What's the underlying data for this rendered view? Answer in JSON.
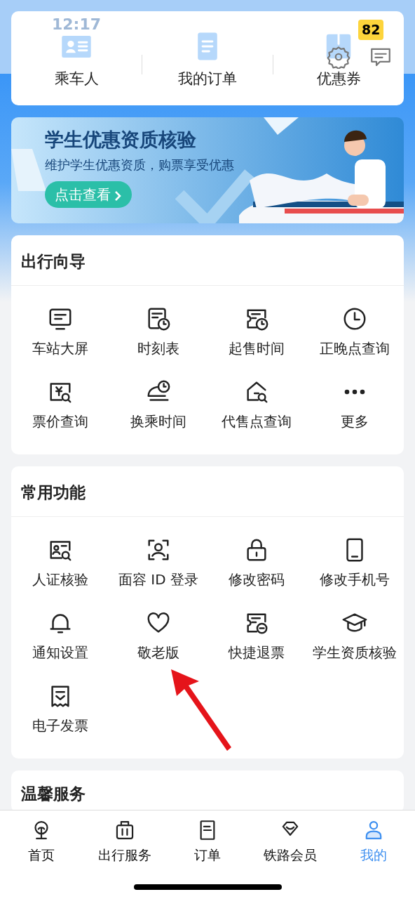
{
  "status_bar": {
    "time": "12:17",
    "badge": "82"
  },
  "shortcuts": [
    {
      "label": "乘车人"
    },
    {
      "label": "我的订单"
    },
    {
      "label": "优惠券"
    }
  ],
  "banner": {
    "title": "学生优惠资质核验",
    "subtitle": "维护学生优惠资质，购票享受优惠",
    "button": "点击查看"
  },
  "sections": [
    {
      "title": "出行向导",
      "items": [
        {
          "label": "车站大屏"
        },
        {
          "label": "时刻表"
        },
        {
          "label": "起售时间"
        },
        {
          "label": "正晚点查询"
        },
        {
          "label": "票价查询"
        },
        {
          "label": "换乘时间"
        },
        {
          "label": "代售点查询"
        },
        {
          "label": "更多"
        }
      ]
    },
    {
      "title": "常用功能",
      "items": [
        {
          "label": "人证核验"
        },
        {
          "label": "面容 ID 登录"
        },
        {
          "label": "修改密码"
        },
        {
          "label": "修改手机号"
        },
        {
          "label": "通知设置"
        },
        {
          "label": "敬老版"
        },
        {
          "label": "快捷退票"
        },
        {
          "label": "学生资质核验"
        },
        {
          "label": "电子发票"
        }
      ]
    },
    {
      "title": "温馨服务"
    }
  ],
  "tab_bar": [
    {
      "label": "首页",
      "selected": false
    },
    {
      "label": "出行服务",
      "selected": false
    },
    {
      "label": "订单",
      "selected": false
    },
    {
      "label": "铁路会员",
      "selected": false
    },
    {
      "label": "我的",
      "selected": true
    }
  ]
}
